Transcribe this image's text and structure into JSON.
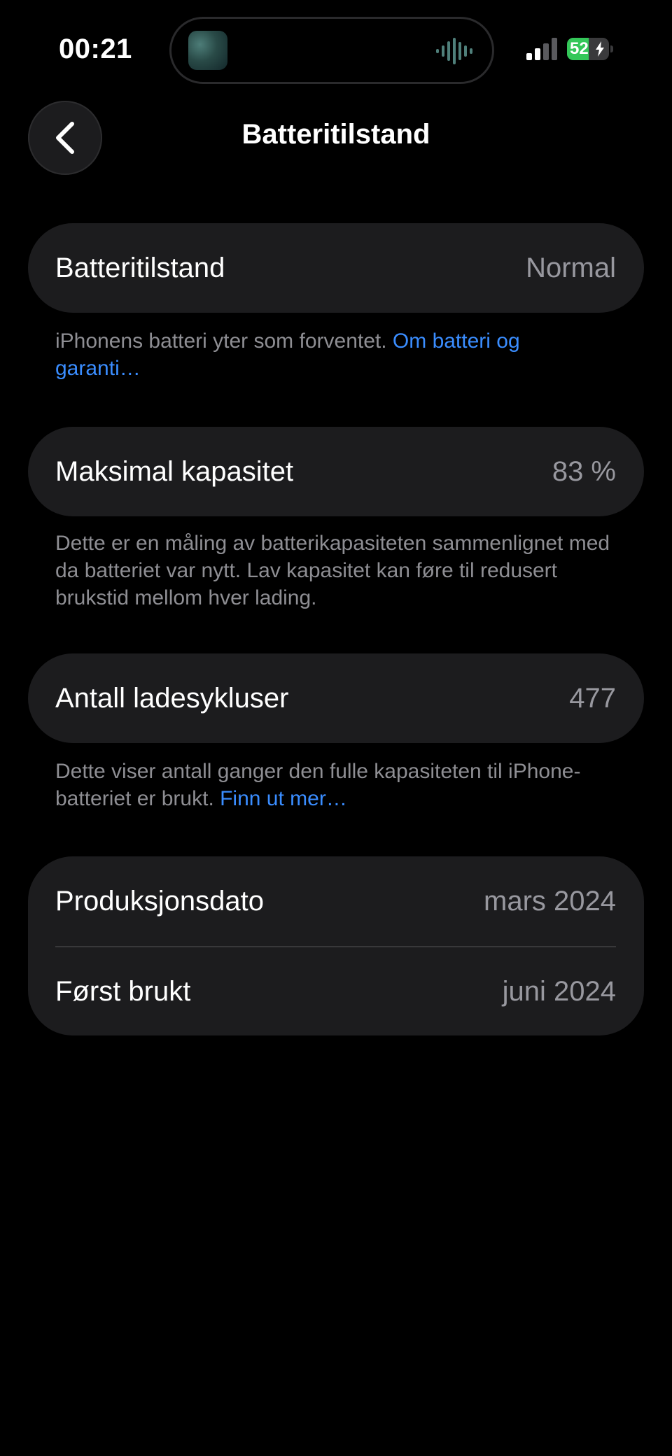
{
  "status_bar": {
    "time": "00:21",
    "battery_percent": "52",
    "battery_level": 0.52,
    "battery_color": "#34c759",
    "icons": [
      "now-playing-artwork-icon",
      "audio-waveform-icon",
      "cellular-signal-icon",
      "battery-charging-icon"
    ]
  },
  "nav": {
    "back_icon": "chevron-left-icon",
    "title": "Batteritilstand"
  },
  "sections": {
    "battery_health": {
      "label": "Batteritilstand",
      "value": "Normal",
      "footnote_text": "iPhonens batteri yter som forventet. ",
      "footnote_link": "Om batteri og garanti…"
    },
    "max_capacity": {
      "label": "Maksimal kapasitet",
      "value": "83 %",
      "footnote_text": "Dette er en måling av batterikapasiteten sammenlignet med da batteriet var nytt. Lav kapasitet kan føre til redusert brukstid mellom hver lading."
    },
    "cycle_count": {
      "label": "Antall ladesykluser",
      "value": "477",
      "footnote_text": "Dette viser antall ganger den fulle kapasiteten til iPhone-batteriet er brukt. ",
      "footnote_link": "Finn ut mer…"
    },
    "dates": {
      "manufacture_label": "Produksjonsdato",
      "manufacture_value": "mars 2024",
      "first_use_label": "Først brukt",
      "first_use_value": "juni 2024"
    }
  },
  "colors": {
    "background": "#000000",
    "card": "#1c1c1e",
    "secondary_text": "#98989f",
    "link": "#3a8dff"
  }
}
